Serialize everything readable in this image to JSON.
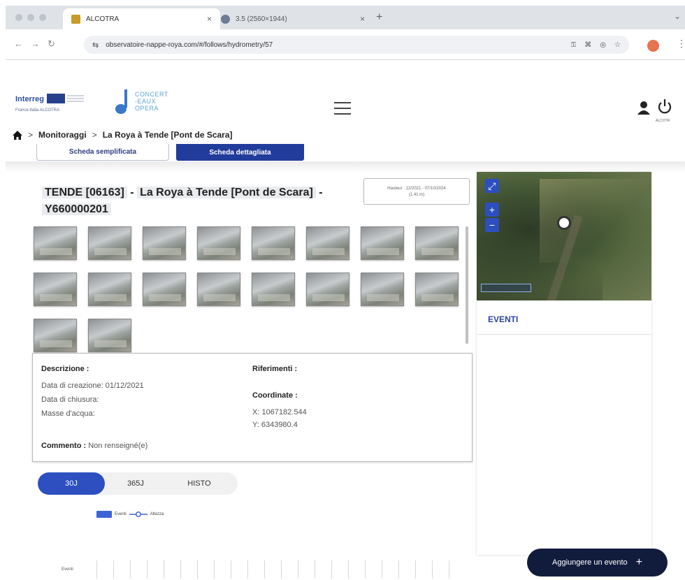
{
  "browser": {
    "tabs": [
      {
        "title": "ALCOTRA",
        "close": "×"
      },
      {
        "title": "3.5 (2560×1944)",
        "close": "×"
      }
    ],
    "new_tab": "+",
    "url": "observatoire-nappe-roya.com/#/follows/hydrometry/57"
  },
  "site": {
    "interreg_name": "Interreg",
    "interreg_sub": "France-Italia ALCOTRA",
    "concert_logo": "CONCERT\n-EAUX\nOPERA",
    "logout_label": "ALCOTR"
  },
  "breadcrumb": {
    "home": "home",
    "items": [
      "Monitoraggi",
      "La Roya à Tende [Pont de Scara]"
    ],
    "separator": ">"
  },
  "view_tabs": [
    "Scheda semplificata",
    "Scheda dettagliata"
  ],
  "station": {
    "code": "TENDE [06163]",
    "name": "La Roya à Tende [Pont de Scara]",
    "id": "Y660000201",
    "dash": "-",
    "date_range": "Hauteur : 12/2021 - 07/10/2024",
    "date_time": "(1.41 m)"
  },
  "thumbnails_count": 18,
  "description": {
    "descrizione_label": "Descrizione :",
    "data_creazione": "Data di creazione:  01/12/2021",
    "data_chiusura": "Data di chiusura:",
    "masse_acqua": "Masse d'acqua:",
    "riferimenti_label": "Riferimenti :",
    "coordinate_label": "Coordinate :",
    "x": "X:  1067182.544",
    "y": "Y:  6343980.4",
    "commento_label": "Commento :",
    "commento_value": "Non renseigné(e)"
  },
  "periods": [
    "30J",
    "365J",
    "HISTO"
  ],
  "legend": {
    "event": "Eventi",
    "height": "Altezza"
  },
  "chart_axis_label": "Eventi",
  "map": {
    "zoom_in": "+",
    "zoom_out": "−",
    "expand": "⤢"
  },
  "events_panel": {
    "title": "EVENTI"
  },
  "add_event": {
    "label": "Aggiungere un evento",
    "icon": "+"
  },
  "colors": {
    "primary": "#2d4fbf",
    "header_tab": "#213c9a",
    "dark_button": "#111c3d"
  }
}
